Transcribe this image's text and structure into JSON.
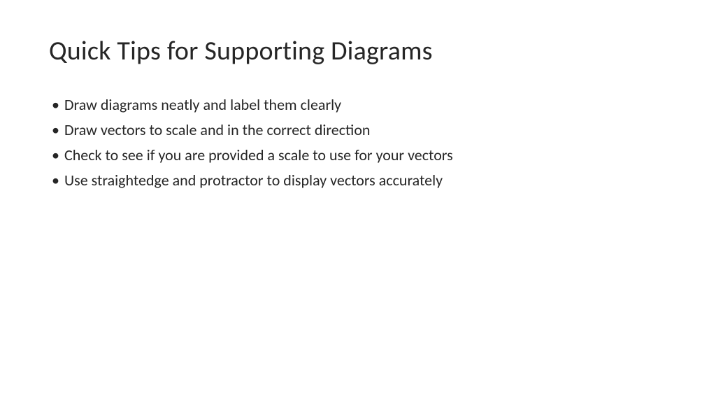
{
  "slide": {
    "title": "Quick Tips for Supporting Diagrams",
    "bullets": [
      "Draw diagrams neatly and label them clearly",
      "Draw vectors to scale and in the correct direction",
      "Check to see if you are provided a scale to use for your vectors",
      "Use straightedge and protractor to display vectors accurately"
    ]
  }
}
